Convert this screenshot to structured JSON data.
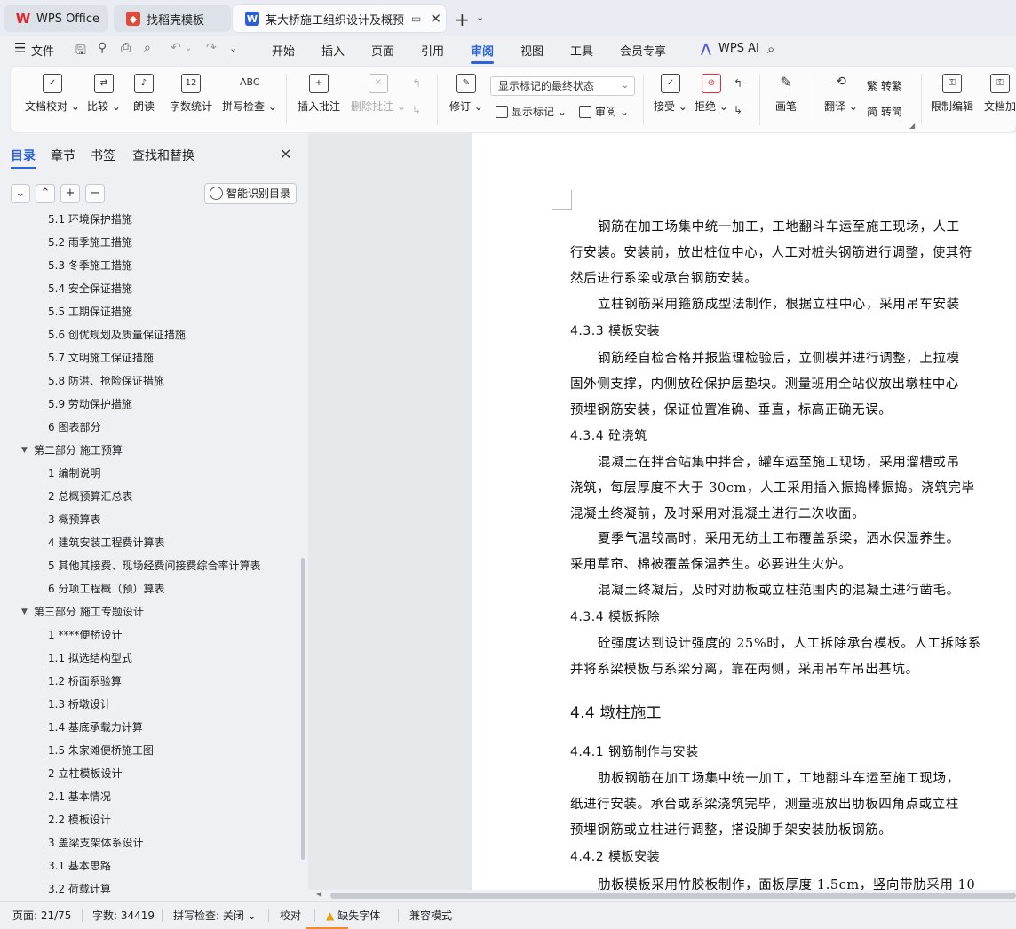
{
  "tabs": [
    {
      "label": "WPS Office",
      "icon": "wps-logo-icon"
    },
    {
      "label": "找稻壳模板",
      "icon": "docer-icon"
    },
    {
      "label": "某大桥施工组织设计及概预算",
      "icon": "writer-doc-icon",
      "active": true
    }
  ],
  "menu": {
    "file": "文件",
    "items": [
      "开始",
      "插入",
      "页面",
      "引用",
      "审阅",
      "视图",
      "工具",
      "会员专享"
    ],
    "active": "审阅",
    "ai": "WPS AI"
  },
  "ribbon": {
    "doc_check": "文档校对",
    "compare": "比较",
    "read_aloud": "朗读",
    "word_count": "字数统计",
    "spell_check": "拼写检查",
    "spell_icon_text": "ABC",
    "count_icon_text": "12",
    "insert_comment": "插入批注",
    "delete_comment": "删除批注",
    "track_changes": "修订",
    "markup_mode": "显示标记的最终状态",
    "show_markup": "显示标记",
    "review_pane": "审阅",
    "accept": "接受",
    "reject": "拒绝",
    "ink": "画笔",
    "translate": "翻译",
    "to_traditional": "转繁",
    "to_simplified": "转简",
    "restrict_edit": "限制编辑",
    "doc_encrypt": "文档加"
  },
  "nav": {
    "tabs": [
      "目录",
      "章节",
      "书签",
      "查找和替换"
    ],
    "active": "目录",
    "smart_toc": "智能识别目录",
    "items": [
      {
        "text": "5.1 环境保护措施",
        "level": 2
      },
      {
        "text": "5.2 雨季施工措施",
        "level": 2
      },
      {
        "text": "5.3 冬季施工措施",
        "level": 2
      },
      {
        "text": "5.4 安全保证措施",
        "level": 2
      },
      {
        "text": "5.5 工期保证措施",
        "level": 2
      },
      {
        "text": "5.6 创优规划及质量保证措施",
        "level": 2
      },
      {
        "text": "5.7 文明施工保证措施",
        "level": 2
      },
      {
        "text": "5.8 防洪、抢险保证措施",
        "level": 2
      },
      {
        "text": "5.9 劳动保护措施",
        "level": 2
      },
      {
        "text": "6 图表部分",
        "level": 2
      },
      {
        "text": "第二部分 施工预算",
        "level": 1
      },
      {
        "text": "1 编制说明",
        "level": 2
      },
      {
        "text": "2 总概预算汇总表",
        "level": 2
      },
      {
        "text": "3 概预算表",
        "level": 2
      },
      {
        "text": "4 建筑安装工程费计算表",
        "level": 2
      },
      {
        "text": "5 其他其接费、现场经费间接费综合率计算表",
        "level": 2
      },
      {
        "text": "6 分项工程概（预）算表",
        "level": 2
      },
      {
        "text": "第三部分 施工专题设计",
        "level": 1
      },
      {
        "text": "1 ****便桥设计",
        "level": 2
      },
      {
        "text": "1.1 拟选结构型式",
        "level": 2
      },
      {
        "text": "1.2 桥面系验算",
        "level": 2
      },
      {
        "text": "1.3 桥墩设计",
        "level": 2
      },
      {
        "text": "1.4 基底承载力计算",
        "level": 2
      },
      {
        "text": "1.5 朱家滩便桥施工图",
        "level": 2
      },
      {
        "text": "2 立柱模板设计",
        "level": 2
      },
      {
        "text": "2.1 基本情况",
        "level": 2
      },
      {
        "text": "2.2 模板设计",
        "level": 2
      },
      {
        "text": "3 盖梁支架体系设计",
        "level": 2
      },
      {
        "text": "3.1 基本思路",
        "level": 2
      },
      {
        "text": "3.2 荷载计算",
        "level": 2
      }
    ]
  },
  "doc": {
    "lines": [
      {
        "text": "钢筋在加工场集中统一加工，工地翻斗车运至施工现场，人工",
        "kind": "indent"
      },
      {
        "text": "行安装。安装前，放出桩位中心，人工对桩头钢筋进行调整，使其符",
        "kind": "body"
      },
      {
        "text": "然后进行系梁或承台钢筋安装。",
        "kind": "body"
      },
      {
        "text": "立柱钢筋采用箍筋成型法制作，根据立柱中心，采用吊车安装",
        "kind": "indent"
      },
      {
        "text": "4.3.3  模板安装",
        "kind": "head"
      },
      {
        "text": "钢筋经自检合格并报监理检验后，立侧模并进行调整，上拉模",
        "kind": "indent"
      },
      {
        "text": "固外侧支撑，内侧放砼保护层垫块。测量班用全站仪放出墩柱中心",
        "kind": "body"
      },
      {
        "text": "预埋钢筋安装，保证位置准确、垂直，标高正确无误。",
        "kind": "body"
      },
      {
        "text": "4.3.4  砼浇筑",
        "kind": "head"
      },
      {
        "text": "混凝土在拌合站集中拌合，罐车运至施工现场，采用溜槽或吊",
        "kind": "indent"
      },
      {
        "text": "浇筑，每层厚度不大于 30cm，人工采用插入振捣棒振捣。浇筑完毕",
        "kind": "body"
      },
      {
        "text": "混凝土终凝前，及时采用对混凝土进行二次收面。",
        "kind": "body"
      },
      {
        "text": "夏季气温较高时，采用无纺土工布覆盖系梁，洒水保湿养生。",
        "kind": "indent"
      },
      {
        "text": "采用草帘、棉被覆盖保温养生。必要进生火炉。",
        "kind": "body"
      },
      {
        "text": "混凝土终凝后，及时对肋板或立柱范围内的混凝土进行凿毛。",
        "kind": "indent"
      },
      {
        "text": "4.3.4  模板拆除",
        "kind": "head"
      },
      {
        "text": "砼强度达到设计强度的 25%时，人工拆除承台模板。人工拆除系",
        "kind": "indent"
      },
      {
        "text": "并将系梁模板与系梁分离，靠在两侧，采用吊车吊出基坑。",
        "kind": "body"
      },
      {
        "text": "4.4 墩柱施工",
        "kind": "bighead"
      },
      {
        "text": "4.4.1  钢筋制作与安装",
        "kind": "head"
      },
      {
        "text": "肋板钢筋在加工场集中统一加工，工地翻斗车运至施工现场，",
        "kind": "indent"
      },
      {
        "text": "纸进行安装。承台或系梁浇筑完毕，测量班放出肋板四角点或立柱",
        "kind": "body"
      },
      {
        "text": "预埋钢筋或立柱进行调整，搭设脚手架安装肋板钢筋。",
        "kind": "body"
      },
      {
        "text": "4.4.2  模板安装",
        "kind": "head"
      },
      {
        "text": "肋板模板采用竹胶板制作，面板厚度 1.5cm，竖向带肋采用 10",
        "kind": "indent"
      }
    ]
  },
  "status": {
    "page": "页面: 21/75",
    "words": "字数: 34419",
    "spell": "拼写检查: 关闭",
    "proofread": "校对",
    "missing_font": "缺失字体",
    "compat": "兼容模式"
  }
}
